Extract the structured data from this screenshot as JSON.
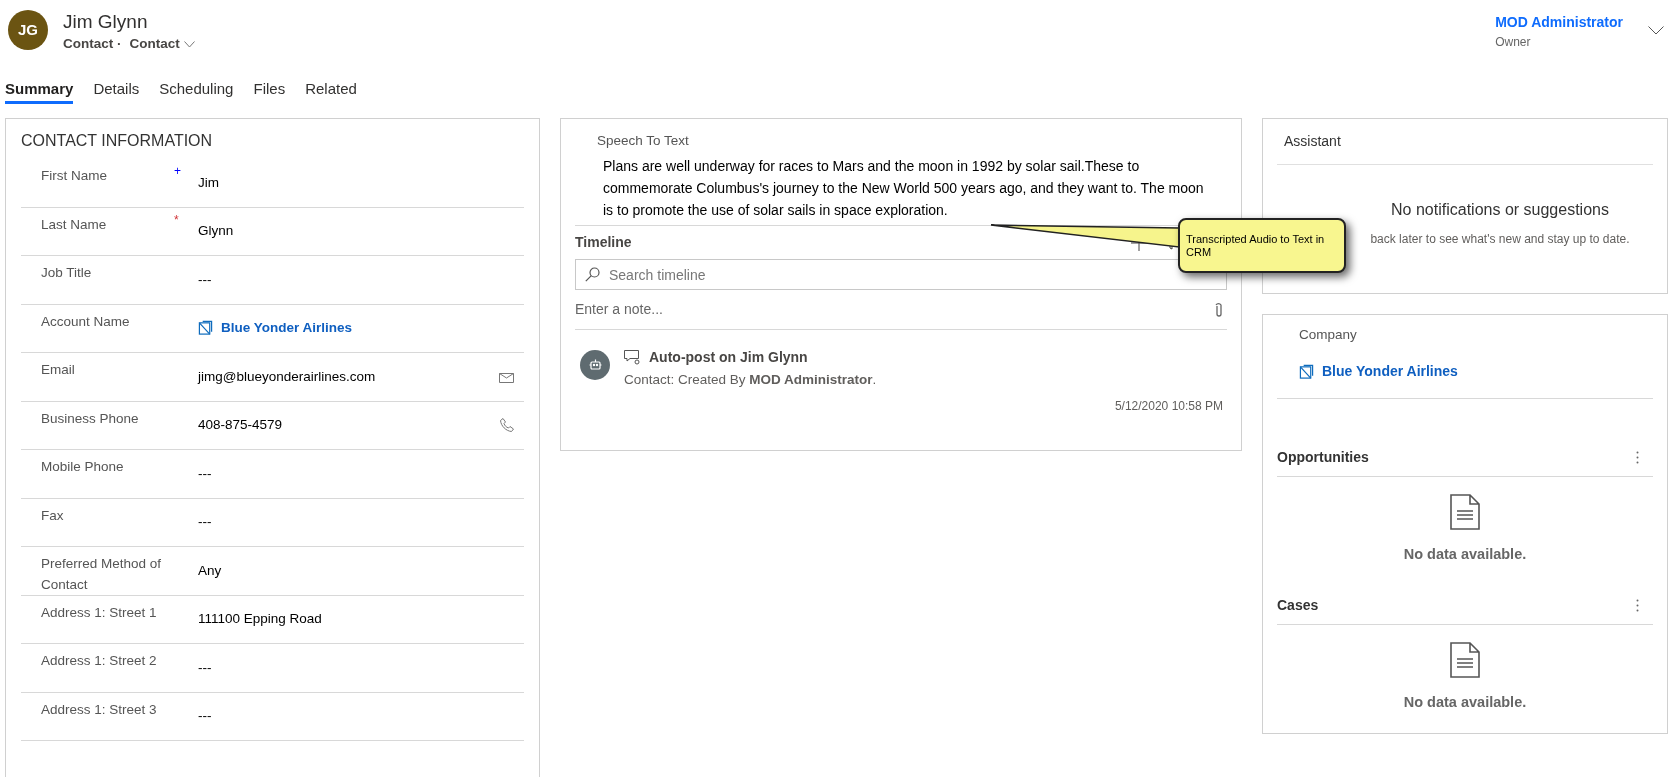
{
  "header": {
    "initials": "JG",
    "name": "Jim Glynn",
    "entity": "Contact ·",
    "form": "Contact",
    "owner_name": "MOD Administrator",
    "owner_label": "Owner"
  },
  "tabs": [
    {
      "label": "Summary",
      "selected": true
    },
    {
      "label": "Details",
      "selected": false
    },
    {
      "label": "Scheduling",
      "selected": false
    },
    {
      "label": "Files",
      "selected": false
    },
    {
      "label": "Related",
      "selected": false
    }
  ],
  "contact_information": {
    "title": "CONTACT INFORMATION",
    "fields": [
      {
        "label": "First Name",
        "marker": {
          "symbol": "+",
          "kind": "recommended"
        },
        "value": "Jim",
        "kind": "text"
      },
      {
        "label": "Last Name",
        "marker": {
          "symbol": "*",
          "kind": "required"
        },
        "value": "Glynn",
        "kind": "text"
      },
      {
        "label": "Job Title",
        "value": "---",
        "kind": "text"
      },
      {
        "label": "Account Name",
        "value": "Blue Yonder Airlines",
        "kind": "link"
      },
      {
        "label": "Email",
        "value": "jimg@blueyonderairlines.com",
        "kind": "email"
      },
      {
        "label": "Business Phone",
        "value": "408-875-4579",
        "kind": "phone"
      },
      {
        "label": "Mobile Phone",
        "value": "---",
        "kind": "text"
      },
      {
        "label": "Fax",
        "value": "---",
        "kind": "text"
      },
      {
        "label": "Preferred Method of Contact",
        "value": "Any",
        "kind": "text"
      },
      {
        "label": "Address 1: Street 1",
        "value": "111100 Epping Road",
        "kind": "text"
      },
      {
        "label": "Address 1: Street 2",
        "value": "---",
        "kind": "text"
      },
      {
        "label": "Address 1: Street 3",
        "value": "---",
        "kind": "text"
      }
    ]
  },
  "speech_to_text": {
    "label": "Speech To Text",
    "text": "Plans are well underway for races to Mars and the moon in 1992 by solar sail.These to commemorate Columbus's journey to the New World 500 years ago, and they want to. The moon is to promote the use of solar sails in space exploration."
  },
  "timeline": {
    "title": "Timeline",
    "search_placeholder": "Search timeline",
    "note_placeholder": "Enter a note...",
    "posts": [
      {
        "title": "Auto-post on Jim Glynn",
        "body": "Contact: Created By **MOD Administrator**.",
        "time": "5/12/2020 10:58 PM"
      }
    ]
  },
  "callout": {
    "text": "Transcripted Audio to Text in CRM"
  },
  "assistant": {
    "title": "Assistant",
    "heading": "No notifications or suggestions",
    "body": "back later to see what's new and stay up to date."
  },
  "company": {
    "label": "Company",
    "value": "Blue Yonder Airlines"
  },
  "subgrids": [
    {
      "title": "Opportunities",
      "empty_text": "No data available."
    },
    {
      "title": "Cases",
      "empty_text": "No data available."
    }
  ]
}
